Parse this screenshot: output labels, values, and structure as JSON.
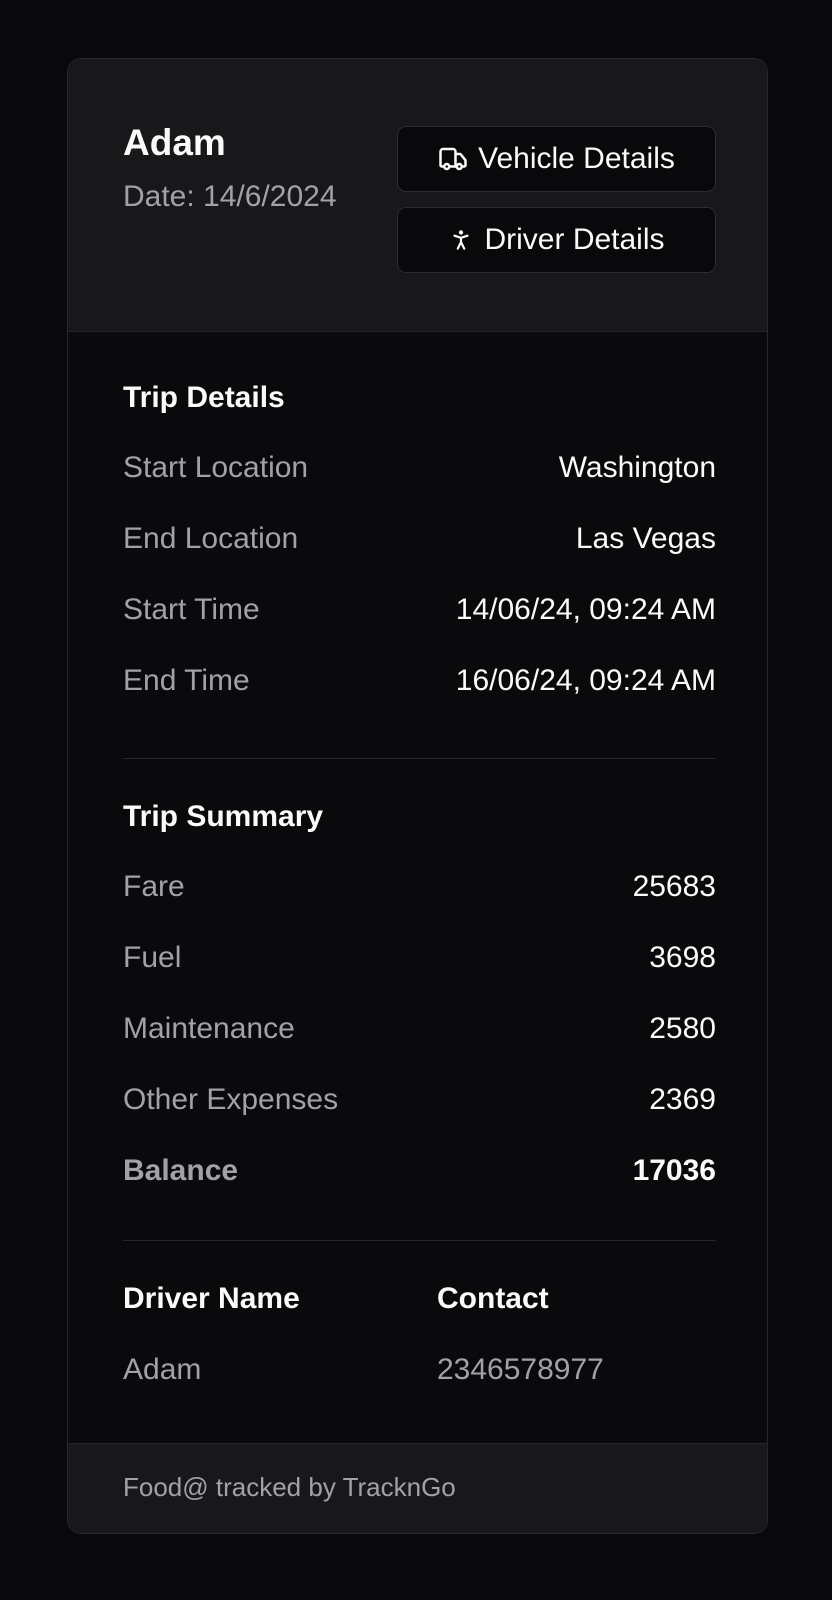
{
  "header": {
    "title": "Adam",
    "date": "Date: 14/6/2024",
    "vehicle_button": "Vehicle Details",
    "driver_button": "Driver Details"
  },
  "trip_details": {
    "title": "Trip Details",
    "rows": [
      {
        "label": "Start Location",
        "value": "Washington"
      },
      {
        "label": "End Location",
        "value": "Las Vegas"
      },
      {
        "label": "Start Time",
        "value": "14/06/24, 09:24 AM"
      },
      {
        "label": "End Time",
        "value": "16/06/24, 09:24 AM"
      }
    ]
  },
  "trip_summary": {
    "title": "Trip Summary",
    "rows": [
      {
        "label": "Fare",
        "value": "25683"
      },
      {
        "label": "Fuel",
        "value": "3698"
      },
      {
        "label": "Maintenance",
        "value": "2580"
      },
      {
        "label": "Other Expenses",
        "value": "2369"
      },
      {
        "label": "Balance",
        "value": "17036"
      }
    ]
  },
  "driver": {
    "name_header": "Driver Name",
    "contact_header": "Contact",
    "name": "Adam",
    "contact": "2346578977"
  },
  "footer": {
    "text": "Food@ tracked by TracknGo"
  },
  "icons": {
    "vehicle": "truck-icon",
    "driver": "person-standing-icon"
  },
  "colors": {
    "background": "#09090b",
    "card": "#0a0a0c",
    "header": "#18181b",
    "text": "#fafafa",
    "muted": "#a1a1aa",
    "border": "#27272a"
  }
}
